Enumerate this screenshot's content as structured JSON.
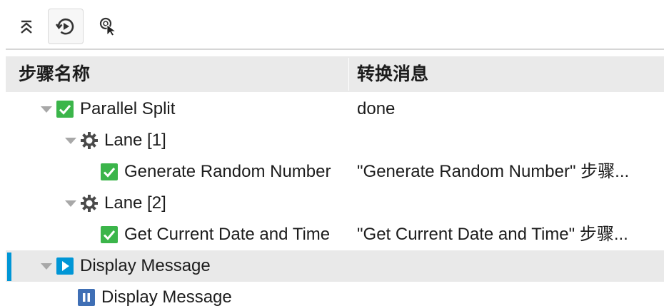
{
  "toolbar": {
    "buttons": [
      {
        "icon": "collapse-all-icon",
        "active": false
      },
      {
        "icon": "replay-icon",
        "active": true
      },
      {
        "icon": "pointer-search-icon",
        "active": false
      }
    ]
  },
  "columns": {
    "name": "步骤名称",
    "message": "转换消息"
  },
  "rows": [
    {
      "name": "Parallel Split",
      "message": "done",
      "icon": "check-icon",
      "expanded": true
    },
    {
      "name": "Lane [1]",
      "message": "",
      "icon": "gear-icon",
      "expanded": true
    },
    {
      "name": "Generate Random Number",
      "message": "\"Generate Random Number\" 步骤...",
      "icon": "check-icon"
    },
    {
      "name": "Lane [2]",
      "message": "",
      "icon": "gear-icon",
      "expanded": true
    },
    {
      "name": "Get Current Date and Time",
      "message": "\"Get Current Date and Time\" 步骤...",
      "icon": "check-icon"
    },
    {
      "name": "Display Message",
      "message": "",
      "icon": "play-icon",
      "expanded": true,
      "selected": true
    },
    {
      "name": "Display Message",
      "message": "",
      "icon": "pause-icon"
    }
  ],
  "colors": {
    "success": "#3bb54a",
    "accent": "#0096d6",
    "pause": "#3f6fb5",
    "selected_row": "#e9e9e9",
    "header_bg": "#eaeaea"
  }
}
